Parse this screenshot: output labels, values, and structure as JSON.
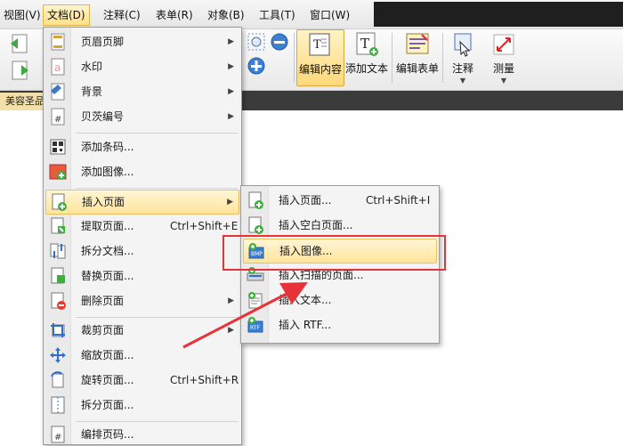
{
  "menubar": {
    "items": [
      "视图(V)",
      "文档(D)",
      "注释(C)",
      "表单(R)",
      "对象(B)",
      "工具(T)",
      "窗口(W)"
    ]
  },
  "toolbar": {
    "edit_content": "编辑内容",
    "add_text": "添加文本",
    "edit_form": "编辑表单",
    "annotate": "注释",
    "measure": "测量"
  },
  "tabbar": {
    "doc_tab": "美容圣品-"
  },
  "document_menu": {
    "items": [
      {
        "label": "页眉页脚",
        "icon": "header-footer-icon",
        "submenu": true
      },
      {
        "label": "水印",
        "icon": "watermark-icon",
        "submenu": true
      },
      {
        "label": "背景",
        "icon": "background-icon",
        "submenu": true
      },
      {
        "label": "贝茨编号",
        "icon": "bates-number-icon",
        "submenu": true
      },
      {
        "label": "添加条码...",
        "icon": "barcode-icon"
      },
      {
        "label": "添加图像...",
        "icon": "add-image-icon"
      },
      {
        "label": "插入页面",
        "icon": "insert-page-icon",
        "submenu": true
      },
      {
        "label": "提取页面...",
        "icon": "extract-page-icon",
        "shortcut": "Ctrl+Shift+E"
      },
      {
        "label": "拆分文档...",
        "icon": "split-document-icon"
      },
      {
        "label": "替换页面...",
        "icon": "replace-page-icon"
      },
      {
        "label": "删除页面",
        "icon": "delete-page-icon",
        "submenu": true
      },
      {
        "label": "裁剪页面",
        "icon": "crop-page-icon",
        "submenu": true
      },
      {
        "label": "缩放页面...",
        "icon": "scale-page-icon"
      },
      {
        "label": "旋转页面...",
        "icon": "rotate-page-icon",
        "shortcut": "Ctrl+Shift+R"
      },
      {
        "label": "拆分页面...",
        "icon": "split-page-icon"
      },
      {
        "label": "编排页码...",
        "icon": "number-pages-icon"
      }
    ]
  },
  "insert_submenu": {
    "items": [
      {
        "label": "插入页面...",
        "shortcut": "Ctrl+Shift+I",
        "icon": "insert-page-icon"
      },
      {
        "label": "插入空白页面...",
        "icon": "insert-blank-page-icon"
      },
      {
        "label": "插入图像...",
        "icon": "insert-image-bmp-icon"
      },
      {
        "label": "插入扫描的页面...",
        "icon": "insert-scanned-page-icon"
      },
      {
        "label": "插入文本...",
        "icon": "insert-text-icon"
      },
      {
        "label": "插入 RTF...",
        "icon": "insert-rtf-icon"
      }
    ]
  },
  "colors": {
    "highlight": "#ffe49a",
    "annotation_red": "#e8323a",
    "tabbar": "#3b3b3b"
  }
}
